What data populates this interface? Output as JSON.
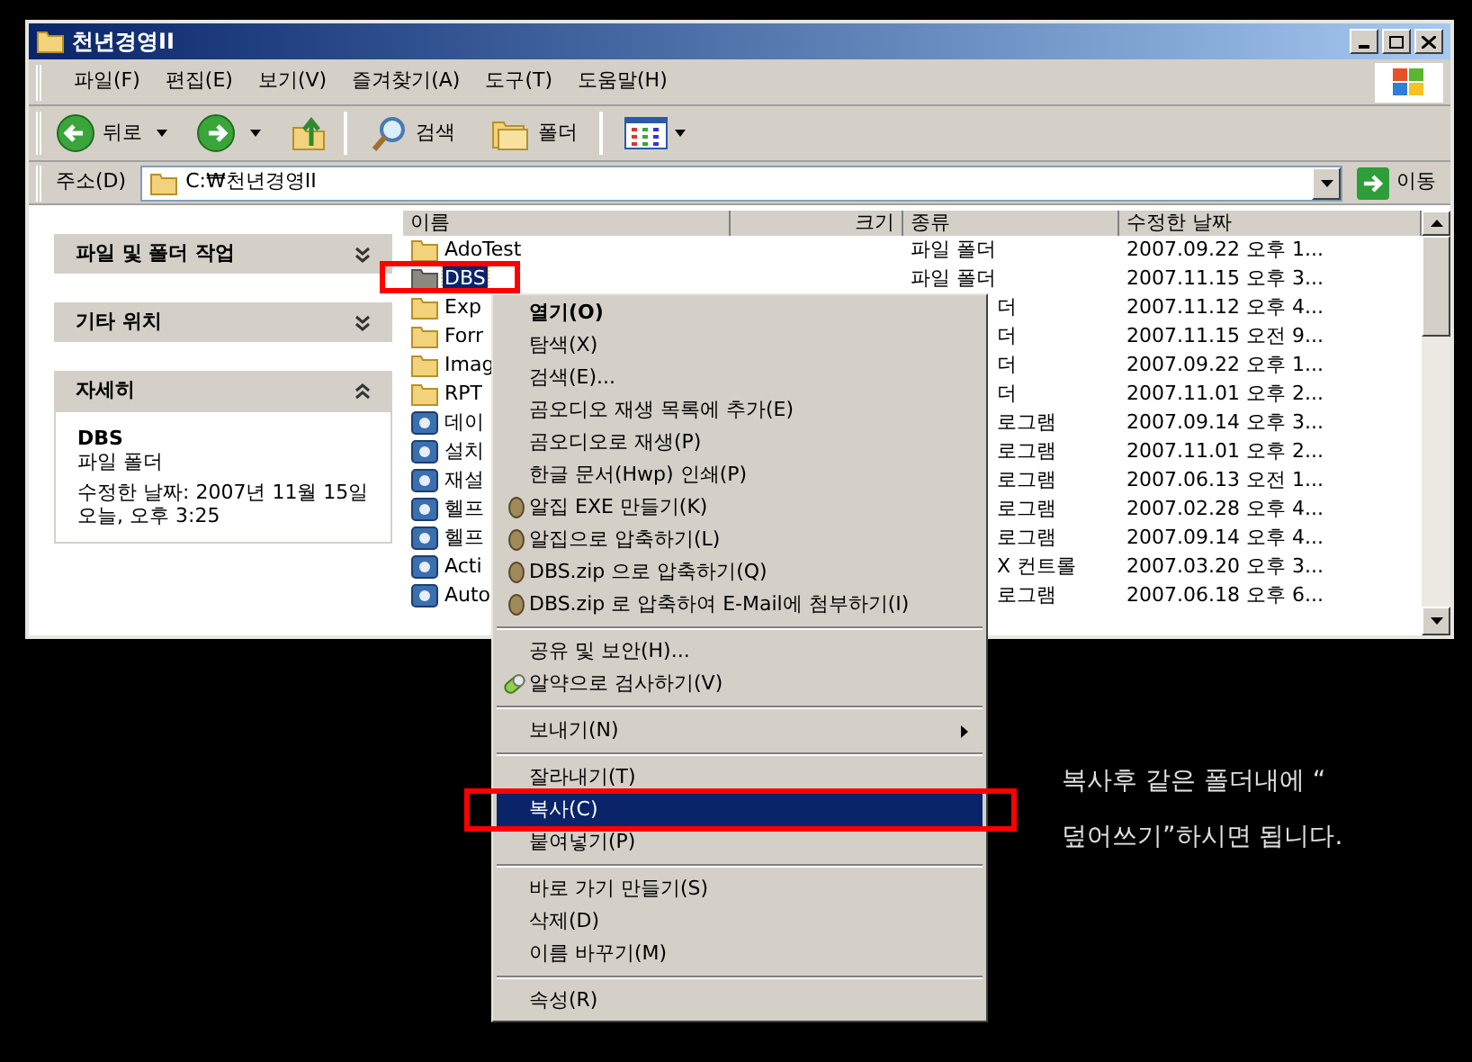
{
  "window": {
    "title": "천년경영II"
  },
  "menu_bar": [
    "파일(F)",
    "편집(E)",
    "보기(V)",
    "즐겨찾기(A)",
    "도구(T)",
    "도움말(H)"
  ],
  "toolbar": {
    "back": "뒤로",
    "search": "검색",
    "folders": "폴더"
  },
  "address_bar": {
    "label": "주소(D)",
    "value": "C:₩천년경영II",
    "go": "이동"
  },
  "task_pane": [
    {
      "title": "파일 및 폴더 작업",
      "expanded": false
    },
    {
      "title": "기타 위치",
      "expanded": false
    },
    {
      "title": "자세히",
      "expanded": true,
      "name": "DBS",
      "type": "파일 폴더",
      "detail": "수정한 날짜: 2007년 11월 15일 오늘, 오후 3:25"
    }
  ],
  "file_list": {
    "columns": [
      "이름",
      "크기",
      "종류",
      "수정한 날짜"
    ],
    "rows": [
      {
        "kind": "folder",
        "name": "AdoTest",
        "type": "파일 폴더",
        "date": "2007.09.22 오후 1...",
        "selected": false
      },
      {
        "kind": "folder",
        "name": "DBS",
        "type": "파일 폴더",
        "date": "2007.11.15 오후 3...",
        "selected": true
      },
      {
        "kind": "folder",
        "name": "Exp",
        "type": "더",
        "date": "2007.11.12 오후 4...",
        "selected": false
      },
      {
        "kind": "folder",
        "name": "Forr",
        "type": "더",
        "date": "2007.11.15 오전 9...",
        "selected": false
      },
      {
        "kind": "folder",
        "name": "Imag",
        "type": "더",
        "date": "2007.09.22 오후 1...",
        "selected": false
      },
      {
        "kind": "folder",
        "name": "RPT",
        "type": "더",
        "date": "2007.11.01 오후 2...",
        "selected": false
      },
      {
        "kind": "program",
        "name": "데이",
        "type": "로그램",
        "date": "2007.09.14 오후 3...",
        "selected": false
      },
      {
        "kind": "program",
        "name": "설치",
        "type": "로그램",
        "date": "2007.11.01 오후 2...",
        "selected": false
      },
      {
        "kind": "program",
        "name": "재설",
        "type": "로그램",
        "date": "2007.06.13 오전 1...",
        "selected": false
      },
      {
        "kind": "program",
        "name": "헬프",
        "type": "로그램",
        "date": "2007.02.28 오후 4...",
        "selected": false
      },
      {
        "kind": "program",
        "name": "헬프",
        "type": "로그램",
        "date": "2007.09.14 오후 4...",
        "selected": false
      },
      {
        "kind": "program",
        "name": "Acti",
        "type": "X 컨트롤",
        "date": "2007.03.20 오후 3...",
        "selected": false
      },
      {
        "kind": "program",
        "name": "Auto",
        "type": "로그램",
        "date": "2007.06.18 오후 6...",
        "selected": false
      }
    ]
  },
  "context_menu": [
    {
      "kind": "plain",
      "label": "열기(O)",
      "default": true,
      "selected": false
    },
    {
      "kind": "plain",
      "label": "탐색(X)",
      "default": false,
      "selected": false
    },
    {
      "kind": "plain",
      "label": "검색(E)...",
      "default": false,
      "selected": false
    },
    {
      "kind": "plain",
      "label": "곰오디오 재생 목록에 추가(E)",
      "default": false,
      "selected": false
    },
    {
      "kind": "plain",
      "label": "곰오디오로 재생(P)",
      "default": false,
      "selected": false
    },
    {
      "kind": "plain",
      "label": "한글 문서(Hwp) 인쇄(P)",
      "default": false,
      "selected": false
    },
    {
      "kind": "alzip",
      "label": "알집 EXE 만들기(K)",
      "default": false,
      "selected": false
    },
    {
      "kind": "alzip",
      "label": "알집으로 압축하기(L)",
      "default": false,
      "selected": false
    },
    {
      "kind": "alzip",
      "label": "DBS.zip 으로 압축하기(Q)",
      "default": false,
      "selected": false
    },
    {
      "kind": "alzip",
      "label": "DBS.zip 로 압축하여 E-Mail에 첨부하기(I)",
      "default": false,
      "selected": false
    },
    {
      "kind": "separator"
    },
    {
      "kind": "plain",
      "label": "공유 및 보안(H)...",
      "default": false,
      "selected": false
    },
    {
      "kind": "pill",
      "label": "알약으로 검사하기(V)",
      "default": false,
      "selected": false
    },
    {
      "kind": "separator"
    },
    {
      "kind": "submenu",
      "label": "보내기(N)",
      "default": false,
      "selected": false
    },
    {
      "kind": "separator"
    },
    {
      "kind": "plain",
      "label": "잘라내기(T)",
      "default": false,
      "selected": false
    },
    {
      "kind": "plain",
      "label": "복사(C)",
      "default": false,
      "selected": true
    },
    {
      "kind": "plain",
      "label": "붙여넣기(P)",
      "default": false,
      "selected": false
    },
    {
      "kind": "separator"
    },
    {
      "kind": "plain",
      "label": "바로 가기 만들기(S)",
      "default": false,
      "selected": false
    },
    {
      "kind": "plain",
      "label": "삭제(D)",
      "default": false,
      "selected": false
    },
    {
      "kind": "plain",
      "label": "이름 바꾸기(M)",
      "default": false,
      "selected": false
    },
    {
      "kind": "separator"
    },
    {
      "kind": "plain",
      "label": "속성(R)",
      "default": false,
      "selected": false
    }
  ],
  "annotation": [
    "복사후 같은 폴더내에 “",
    "덮어쓰기”하시면 됩니다."
  ]
}
